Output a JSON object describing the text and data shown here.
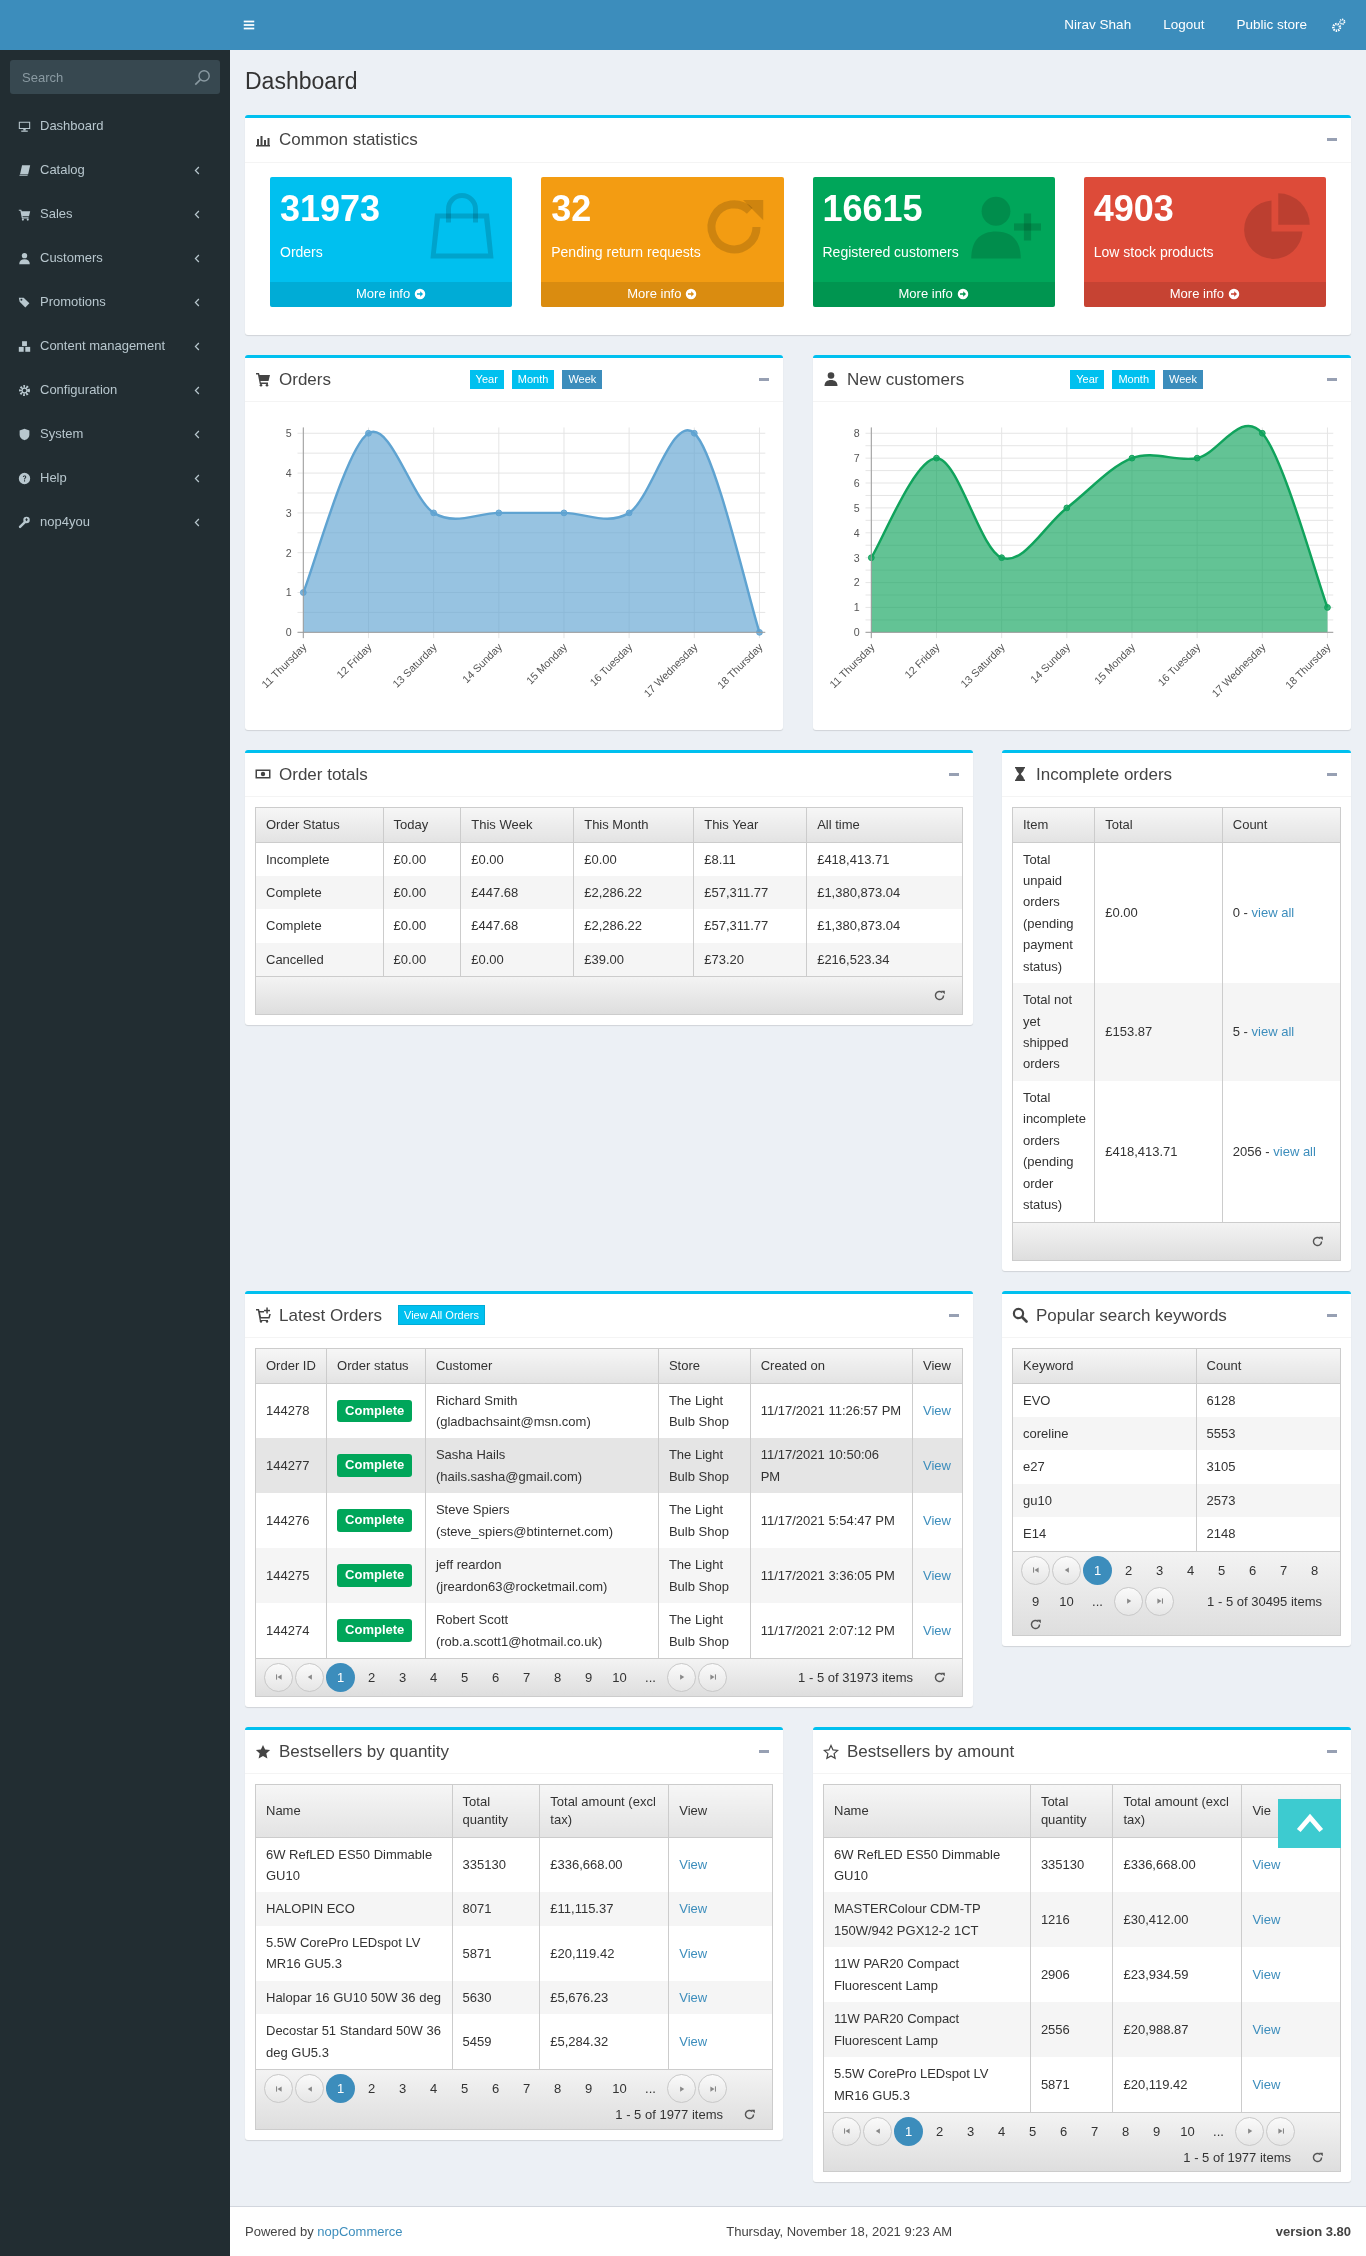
{
  "header": {
    "user": "Nirav Shah",
    "links": [
      "Logout",
      "Public store"
    ]
  },
  "sidebar": {
    "search_placeholder": "Search",
    "items": [
      {
        "label": "Dashboard",
        "kind": "link"
      },
      {
        "label": "Catalog",
        "kind": "group"
      },
      {
        "label": "Sales",
        "kind": "group"
      },
      {
        "label": "Customers",
        "kind": "group"
      },
      {
        "label": "Promotions",
        "kind": "group"
      },
      {
        "label": "Content management",
        "kind": "group"
      },
      {
        "label": "Configuration",
        "kind": "group"
      },
      {
        "label": "System",
        "kind": "group"
      },
      {
        "label": "Help",
        "kind": "group"
      },
      {
        "label": "nop4you",
        "kind": "group"
      }
    ]
  },
  "page_title": "Dashboard",
  "common_statistics": {
    "title": "Common statistics",
    "tiles": [
      {
        "value": "31973",
        "label": "Orders",
        "link": "More info",
        "color": "#00c0ef"
      },
      {
        "value": "32",
        "label": "Pending return requests",
        "link": "More info",
        "color": "#f39c12"
      },
      {
        "value": "16615",
        "label": "Registered customers",
        "link": "More info",
        "color": "#00a65a"
      },
      {
        "value": "4903",
        "label": "Low stock products",
        "link": "More info",
        "color": "#dd4b39"
      }
    ]
  },
  "charts": [
    {
      "title": "Orders",
      "periods": [
        {
          "label": "Year",
          "selected": false
        },
        {
          "label": "Month",
          "selected": false
        },
        {
          "label": "Week",
          "selected": true
        }
      ],
      "chart_data": {
        "type": "area",
        "categories": [
          "11 Thursday",
          "12 Friday",
          "13 Saturday",
          "14 Sunday",
          "15 Monday",
          "16 Tuesday",
          "17 Wednesday",
          "18 Thursday"
        ],
        "ylim": [
          0,
          5
        ],
        "yticks": [
          0,
          1,
          2,
          3,
          4,
          5
        ],
        "grid": true,
        "series": [
          {
            "color": "#5fa3d1",
            "values": [
              1,
              5,
              3,
              3,
              3,
              3,
              5,
              0
            ]
          }
        ]
      }
    },
    {
      "title": "New customers",
      "periods": [
        {
          "label": "Year",
          "selected": false
        },
        {
          "label": "Month",
          "selected": false
        },
        {
          "label": "Week",
          "selected": true
        }
      ],
      "chart_data": {
        "type": "area",
        "categories": [
          "11 Thursday",
          "12 Friday",
          "13 Saturday",
          "14 Sunday",
          "15 Monday",
          "16 Tuesday",
          "17 Wednesday",
          "18 Thursday"
        ],
        "ylim": [
          0,
          8
        ],
        "yticks": [
          0,
          1,
          2,
          3,
          4,
          5,
          6,
          7,
          8
        ],
        "grid": true,
        "series": [
          {
            "color": "#10a35c",
            "values": [
              3,
              7,
              3,
              5,
              7,
              7,
              8,
              1
            ]
          }
        ]
      }
    }
  ],
  "order_totals": {
    "title": "Order totals",
    "columns": [
      "Order Status",
      "Today",
      "This Week",
      "This Month",
      "This Year",
      "All time"
    ],
    "rows": [
      [
        "Incomplete",
        "£0.00",
        "£0.00",
        "£0.00",
        "£8.11",
        "£418,413.71"
      ],
      [
        "Complete",
        "£0.00",
        "£447.68",
        "£2,286.22",
        "£57,311.77",
        "£1,380,873.04"
      ],
      [
        "Complete",
        "£0.00",
        "£447.68",
        "£2,286.22",
        "£57,311.77",
        "£1,380,873.04"
      ],
      [
        "Cancelled",
        "£0.00",
        "£0.00",
        "£39.00",
        "£73.20",
        "£216,523.34"
      ]
    ]
  },
  "incomplete_orders": {
    "title": "Incomplete orders",
    "columns": [
      "Item",
      "Total",
      "Count"
    ],
    "rows": [
      {
        "item": "Total unpaid orders (pending payment status)",
        "total": "£0.00",
        "count": "0 -",
        "link": "view all"
      },
      {
        "item": "Total not yet shipped orders",
        "total": "£153.87",
        "count": "5 -",
        "link": "view all"
      },
      {
        "item": "Total incomplete orders (pending order status)",
        "total": "£418,413.71",
        "count": "2056 -",
        "link": "view all"
      }
    ]
  },
  "latest_orders": {
    "title": "Latest Orders",
    "button": "View All Orders",
    "columns": [
      "Order ID",
      "Order status",
      "Customer",
      "Store",
      "Created on",
      "View"
    ],
    "rows": [
      {
        "order_id": "144278",
        "status": "Complete",
        "customer": "Richard Smith (gladbachsaint@msn.com)",
        "store": "The Light Bulb Shop",
        "created_on": "11/17/2021 11:26:57 PM",
        "view": "View",
        "hovered": false
      },
      {
        "order_id": "144277",
        "status": "Complete",
        "customer": "Sasha Hails (hails.sasha@gmail.com)",
        "store": "The Light Bulb Shop",
        "created_on": "11/17/2021 10:50:06 PM",
        "view": "View",
        "hovered": true
      },
      {
        "order_id": "144276",
        "status": "Complete",
        "customer": "Steve Spiers (steve_spiers@btinternet.com)",
        "store": "The Light Bulb Shop",
        "created_on": "11/17/2021 5:54:47 PM",
        "view": "View",
        "hovered": false
      },
      {
        "order_id": "144275",
        "status": "Complete",
        "customer": "jeff reardon (jreardon63@rocketmail.com)",
        "store": "The Light Bulb Shop",
        "created_on": "11/17/2021 3:36:05 PM",
        "view": "View",
        "hovered": false
      },
      {
        "order_id": "144274",
        "status": "Complete",
        "customer": "Robert Scott (rob.a.scott1@hotmail.co.uk)",
        "store": "The Light Bulb Shop",
        "created_on": "11/17/2021 2:07:12 PM",
        "view": "View",
        "hovered": false
      }
    ],
    "pager": {
      "pages": [
        {
          "label": "1",
          "selected": true
        },
        {
          "label": "2",
          "selected": false
        },
        {
          "label": "3",
          "selected": false
        },
        {
          "label": "4",
          "selected": false
        },
        {
          "label": "5",
          "selected": false
        },
        {
          "label": "6",
          "selected": false
        },
        {
          "label": "7",
          "selected": false
        },
        {
          "label": "8",
          "selected": false
        },
        {
          "label": "9",
          "selected": false
        },
        {
          "label": "10",
          "selected": false
        }
      ],
      "more": "...",
      "summary": "1 - 5 of 31973 items"
    }
  },
  "search_keywords": {
    "title": "Popular search keywords",
    "columns": [
      "Keyword",
      "Count"
    ],
    "rows": [
      [
        "EVO",
        "6128"
      ],
      [
        "coreline",
        "5553"
      ],
      [
        "e27",
        "3105"
      ],
      [
        "gu10",
        "2573"
      ],
      [
        "E14",
        "2148"
      ]
    ],
    "pager": {
      "pages": [
        {
          "label": "1",
          "selected": true
        },
        {
          "label": "2",
          "selected": false
        },
        {
          "label": "3",
          "selected": false
        },
        {
          "label": "4",
          "selected": false
        },
        {
          "label": "5",
          "selected": false
        },
        {
          "label": "6",
          "selected": false
        },
        {
          "label": "7",
          "selected": false
        },
        {
          "label": "8",
          "selected": false
        },
        {
          "label": "9",
          "selected": false
        },
        {
          "label": "10",
          "selected": false
        }
      ],
      "more": "...",
      "summary": "1 - 5 of 30495 items"
    }
  },
  "bestsellers": [
    {
      "title": "Bestsellers by quantity",
      "columns": [
        "Name",
        "Total quantity",
        "Total amount (excl tax)",
        "View"
      ],
      "rows": [
        {
          "name": "6W RefLED ES50 Dimmable GU10",
          "quantity": "335130",
          "amount": "£336,668.00",
          "view": "View"
        },
        {
          "name": "HALOPIN ECO",
          "quantity": "8071",
          "amount": "£11,115.37",
          "view": "View"
        },
        {
          "name": "5.5W CorePro LEDspot LV MR16 GU5.3",
          "quantity": "5871",
          "amount": "£20,119.42",
          "view": "View"
        },
        {
          "name": "Halopar 16 GU10 50W 36 deg",
          "quantity": "5630",
          "amount": "£5,676.23",
          "view": "View"
        },
        {
          "name": "Decostar 51 Standard 50W 36 deg GU5.3",
          "quantity": "5459",
          "amount": "£5,284.32",
          "view": "View"
        }
      ],
      "pager": {
        "pages": [
          {
            "label": "1",
            "selected": true
          },
          {
            "label": "2",
            "selected": false
          },
          {
            "label": "3",
            "selected": false
          },
          {
            "label": "4",
            "selected": false
          },
          {
            "label": "5",
            "selected": false
          },
          {
            "label": "6",
            "selected": false
          },
          {
            "label": "7",
            "selected": false
          },
          {
            "label": "8",
            "selected": false
          },
          {
            "label": "9",
            "selected": false
          },
          {
            "label": "10",
            "selected": false
          }
        ],
        "more": "...",
        "summary": "1 - 5 of 1977 items"
      }
    },
    {
      "title": "Bestsellers by amount",
      "columns": [
        "Name",
        "Total quantity",
        "Total amount (excl tax)",
        "Vie"
      ],
      "rows": [
        {
          "name": "6W RefLED ES50 Dimmable GU10",
          "quantity": "335130",
          "amount": "£336,668.00",
          "view": "View"
        },
        {
          "name": "MASTERColour CDM-TP 150W/942 PGX12-2 1CT",
          "quantity": "1216",
          "amount": "£30,412.00",
          "view": "View"
        },
        {
          "name": "11W PAR20 Compact Fluorescent Lamp",
          "quantity": "2906",
          "amount": "£23,934.59",
          "view": "View"
        },
        {
          "name": "11W PAR20 Compact Fluorescent Lamp",
          "quantity": "2556",
          "amount": "£20,988.87",
          "view": "View"
        },
        {
          "name": "5.5W CorePro LEDspot LV MR16 GU5.3",
          "quantity": "5871",
          "amount": "£20,119.42",
          "view": "View"
        }
      ],
      "pager": {
        "pages": [
          {
            "label": "1",
            "selected": true
          },
          {
            "label": "2",
            "selected": false
          },
          {
            "label": "3",
            "selected": false
          },
          {
            "label": "4",
            "selected": false
          },
          {
            "label": "5",
            "selected": false
          },
          {
            "label": "6",
            "selected": false
          },
          {
            "label": "7",
            "selected": false
          },
          {
            "label": "8",
            "selected": false
          },
          {
            "label": "9",
            "selected": false
          },
          {
            "label": "10",
            "selected": false
          }
        ],
        "more": "...",
        "summary": "1 - 5 of 1977 items"
      }
    }
  ],
  "footer": {
    "powered_by": "Powered by",
    "link": "nopCommerce",
    "date": "Thursday, November 18, 2021 9:23 AM",
    "version": "version 3.80"
  }
}
